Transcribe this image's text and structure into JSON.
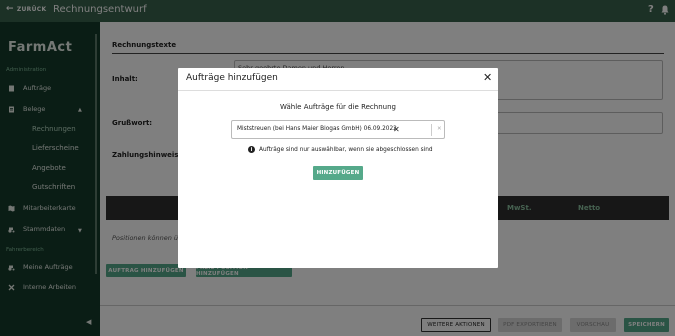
{
  "topbar": {
    "back_label": "ZURÜCK",
    "title": "Rechnungsentwurf",
    "help": "?"
  },
  "sidebar": {
    "logo": "FarmAct",
    "section_admin": "Administration",
    "auftraege": "Aufträge",
    "belege": "Belege",
    "rechnungen": "Rechnungen",
    "lieferscheine": "Lieferscheine",
    "angebote": "Angebote",
    "gutschriften": "Gutschriften",
    "mitarbeiterkarte": "Mitarbeiterkarte",
    "stammdaten": "Stammdaten",
    "section_fahrer": "Fahrerbereich",
    "meine_auftraege": "Meine Aufträge",
    "interne_arbeiten": "Interne Arbeiten"
  },
  "main": {
    "heading": "Rechnungstexte",
    "inhalt_label": "Inhalt:",
    "inhalt_value": "Sehr geehrte Damen und Herren,",
    "gruss_label": "Grußwort:",
    "zahlung_label": "Zahlungshinweis an",
    "col_mwst": "MwSt.",
    "col_netto": "Netto",
    "empty_text": "Positionen können ü",
    "btn_auftrag": "AUFTRAG HINZUFÜGEN",
    "btn_freie": "FREIE POSITION HINZUFÜGEN"
  },
  "bottombar": {
    "weitere": "WEITERE AKTIONEN",
    "pdf": "PDF EXPORTIEREN",
    "vorschau": "VORSCHAU",
    "speichern": "SPEICHERN"
  },
  "modal": {
    "title": "Aufträge hinzufügen",
    "subtitle": "Wähle Aufträge für die Rechnung",
    "selected_chip": "Miststreuen (bei Hans Maier Biogas GmbH) 06.09.2022",
    "info_text": "Aufträge sind nur auswählbar, wenn sie abgeschlossen sind",
    "add_button": "HINZUFÜGEN"
  },
  "colors": {
    "brand_dark": "#143a2a",
    "topbar": "#39624c",
    "accent": "#55a98a"
  }
}
